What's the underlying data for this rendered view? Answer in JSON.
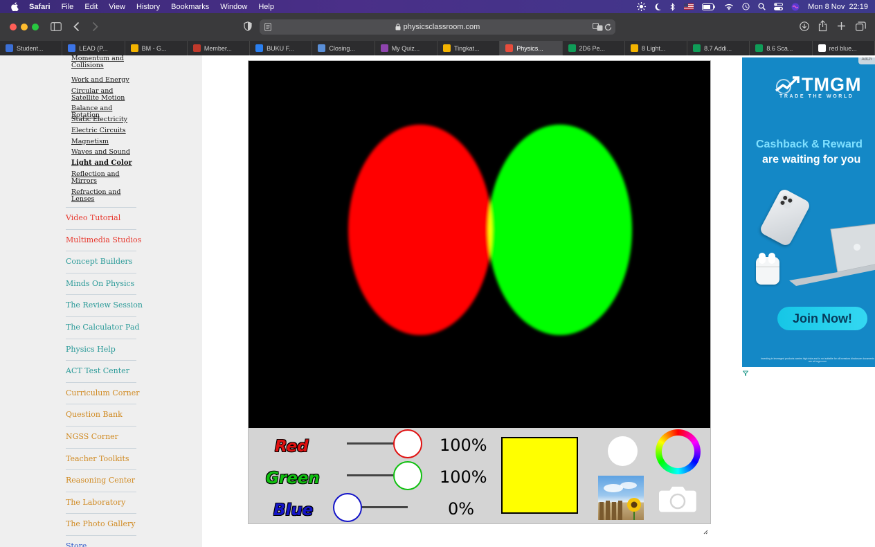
{
  "menubar": {
    "app": "Safari",
    "items": [
      "File",
      "Edit",
      "View",
      "History",
      "Bookmarks",
      "Window",
      "Help"
    ],
    "clock": "Mon 8 Nov  22:19"
  },
  "browser": {
    "url": "physicsclassroom.com",
    "tabs": [
      {
        "label": "Student...",
        "color": "#3b6fd6"
      },
      {
        "label": "LEAD (P...",
        "color": "#3b74e8"
      },
      {
        "label": "BM - G...",
        "color": "#f4b400"
      },
      {
        "label": "Member...",
        "color": "#c0392b"
      },
      {
        "label": "BUKU F...",
        "color": "#2a7ff0"
      },
      {
        "label": "Closing...",
        "color": "#5a8fd8"
      },
      {
        "label": "My Quiz...",
        "color": "#8e44ad"
      },
      {
        "label": "Tingkat...",
        "color": "#f4b400"
      },
      {
        "label": "Physics...",
        "color": "#e74c3c",
        "active": true
      },
      {
        "label": "2D6 Pe...",
        "color": "#0f9d58"
      },
      {
        "label": "8 Light...",
        "color": "#f4b400"
      },
      {
        "label": "8.7 Addi...",
        "color": "#0f9d58"
      },
      {
        "label": "8.6 Sca...",
        "color": "#0f9d58"
      },
      {
        "label": "red blue...",
        "color": "#ffffff"
      }
    ]
  },
  "sidebar": {
    "sub_links": [
      {
        "label": "Momentum and Collisions",
        "bold": false
      },
      {
        "label": "Work and Energy",
        "bold": false
      },
      {
        "label": "Circular and Satellite Motion",
        "bold": false
      },
      {
        "label": "Balance and Rotation",
        "bold": false
      },
      {
        "label": "Static Electricity",
        "bold": false
      },
      {
        "label": "Electric Circuits",
        "bold": false
      },
      {
        "label": "Magnetism",
        "bold": false
      },
      {
        "label": "Waves and Sound",
        "bold": false
      },
      {
        "label": "Light and Color",
        "bold": true
      },
      {
        "label": "Reflection and Mirrors",
        "bold": false
      },
      {
        "label": "Refraction and Lenses",
        "bold": false
      }
    ],
    "main_links": [
      {
        "label": "Video Tutorial",
        "color": "#e8372d"
      },
      {
        "label": "Multimedia Studios",
        "color": "#e8372d"
      },
      {
        "label": "Concept Builders",
        "color": "#2a9a98"
      },
      {
        "label": "Minds On Physics",
        "color": "#2a9a98"
      },
      {
        "label": "The Review Session",
        "color": "#2a9a98"
      },
      {
        "label": "The Calculator Pad",
        "color": "#2a9a98"
      },
      {
        "label": "Physics Help",
        "color": "#2a9a98"
      },
      {
        "label": "ACT Test Center",
        "color": "#2a9a98"
      },
      {
        "label": "Curriculum Corner",
        "color": "#d08a22"
      },
      {
        "label": "Question Bank",
        "color": "#d08a22"
      },
      {
        "label": "NGSS Corner",
        "color": "#d08a22"
      },
      {
        "label": "Teacher Toolkits",
        "color": "#d08a22"
      },
      {
        "label": "Reasoning Center",
        "color": "#d08a22"
      },
      {
        "label": "The Laboratory",
        "color": "#d08a22"
      },
      {
        "label": "The Photo Gallery",
        "color": "#d08a22"
      },
      {
        "label": "Store",
        "color": "#2a55c8"
      }
    ]
  },
  "simulation": {
    "channels": [
      {
        "name": "Red",
        "color": "#e01010",
        "value": 1.0,
        "percent": "100%"
      },
      {
        "name": "Green",
        "color": "#10c010",
        "value": 1.0,
        "percent": "100%"
      },
      {
        "name": "Blue",
        "color": "#1515c8",
        "value": 0.0,
        "percent": "0%"
      }
    ],
    "mixed_color": "#ffff00",
    "circle_colors": {
      "red": "#ff0000",
      "green": "#00ff00",
      "overlap": "#ffff00"
    }
  },
  "ad": {
    "brand": "TMGM",
    "tagline": "TRADE THE WORLD",
    "headline_1": "Cashback & Reward",
    "headline_2": "are waiting for you",
    "cta": "Join Now!",
    "disclaimer": "Investing in leveraged products carries high risks and is not suitable for all investors disclosure documents are at tmgm.com",
    "badge": "AdCh"
  }
}
